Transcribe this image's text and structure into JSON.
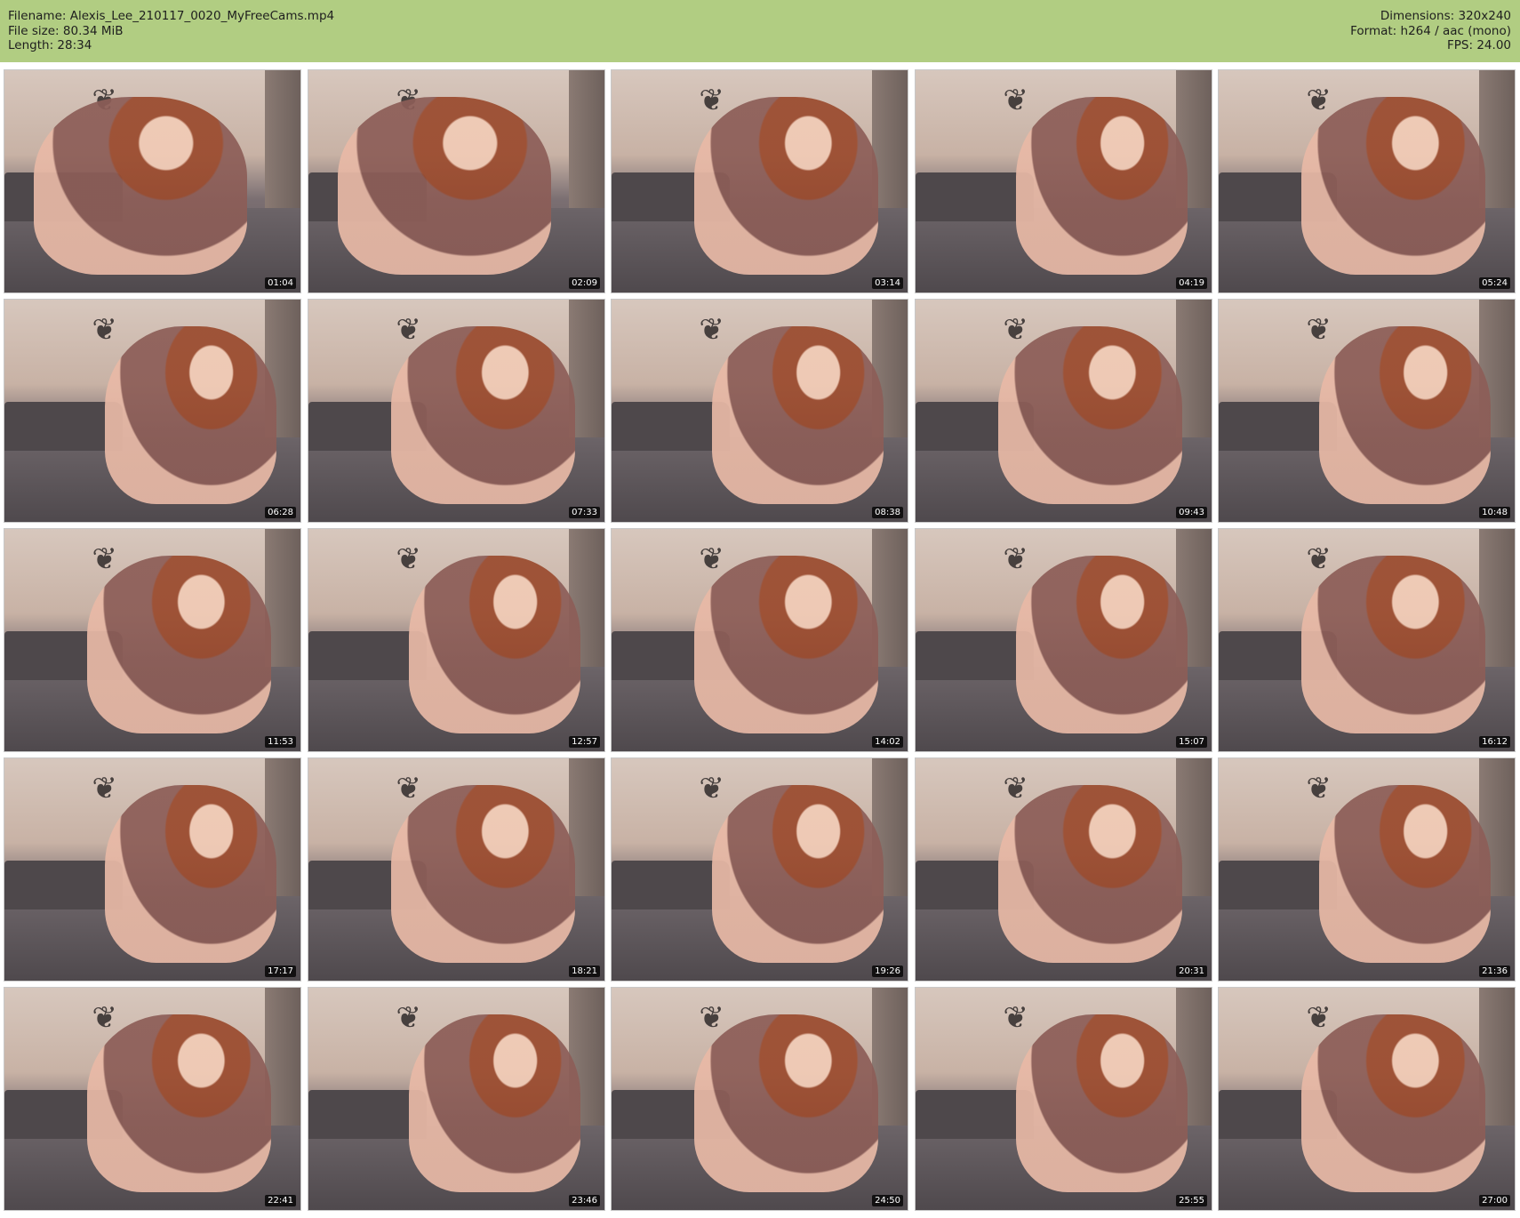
{
  "header": {
    "filename": "Filename: Alexis_Lee_210117_0020_MyFreeCams.mp4",
    "filesize": "File size: 80.34 MiB",
    "length": "Length: 28:34",
    "dimensions": "Dimensions: 320x240",
    "format": "Format: h264 / aac (mono)",
    "fps": "FPS: 24.00"
  },
  "thumbnails": [
    {
      "time": "01:04"
    },
    {
      "time": "02:09"
    },
    {
      "time": "03:14"
    },
    {
      "time": "04:19"
    },
    {
      "time": "05:24"
    },
    {
      "time": "06:28"
    },
    {
      "time": "07:33"
    },
    {
      "time": "08:38"
    },
    {
      "time": "09:43"
    },
    {
      "time": "10:48"
    },
    {
      "time": "11:53"
    },
    {
      "time": "12:57"
    },
    {
      "time": "14:02"
    },
    {
      "time": "15:07"
    },
    {
      "time": "16:12"
    },
    {
      "time": "17:17"
    },
    {
      "time": "18:21"
    },
    {
      "time": "19:26"
    },
    {
      "time": "20:31"
    },
    {
      "time": "21:36"
    },
    {
      "time": "22:41"
    },
    {
      "time": "23:46"
    },
    {
      "time": "24:50"
    },
    {
      "time": "25:55"
    },
    {
      "time": "27:00"
    }
  ],
  "colors": {
    "header_bg": "#b1cd82",
    "timestamp_bg": "#000000"
  }
}
